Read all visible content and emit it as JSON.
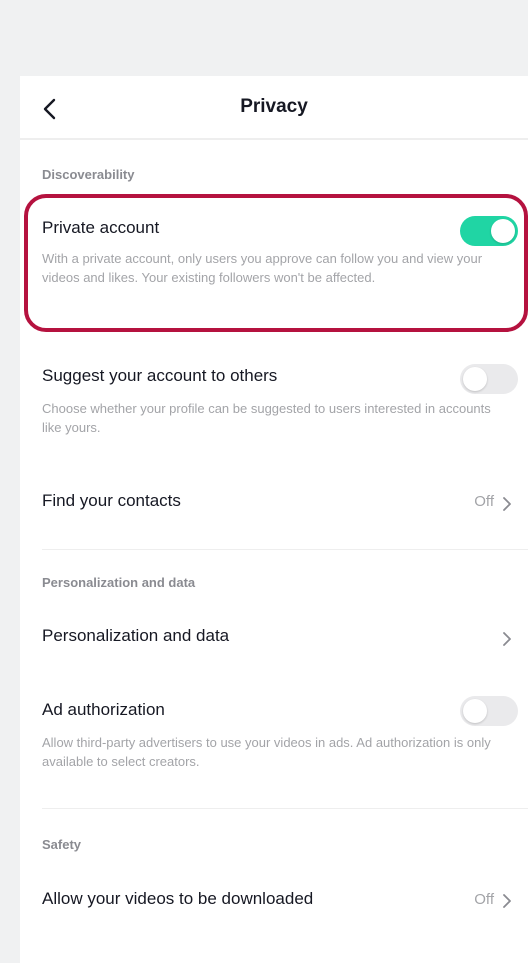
{
  "header": {
    "title": "Privacy",
    "back_icon": "chevron-left-icon"
  },
  "sections": {
    "discoverability": {
      "header": "Discoverability",
      "private_account": {
        "label": "Private account",
        "description": "With a private account, only users you approve can follow you and view your videos and likes. Your existing followers won't be affected.",
        "toggle_state": "on"
      },
      "suggest_account": {
        "label": "Suggest your account to others",
        "description": "Choose whether your profile can be suggested to users interested in accounts like yours.",
        "toggle_state": "off"
      },
      "find_contacts": {
        "label": "Find your contacts",
        "value": "Off"
      }
    },
    "personalization": {
      "header": "Personalization and data",
      "personalization_row": {
        "label": "Personalization and data"
      },
      "ad_authorization": {
        "label": "Ad authorization",
        "description": "Allow third-party advertisers to use your videos in ads. Ad authorization is only available to select creators.",
        "toggle_state": "off"
      }
    },
    "safety": {
      "header": "Safety",
      "downloads": {
        "label": "Allow your videos to be downloaded",
        "value": "Off"
      }
    }
  },
  "colors": {
    "toggle_on": "#20d5a4",
    "toggle_off": "#eaeaec",
    "highlight_border": "#b5123f",
    "text_primary": "#161823",
    "text_secondary": "#a3a4a8"
  }
}
